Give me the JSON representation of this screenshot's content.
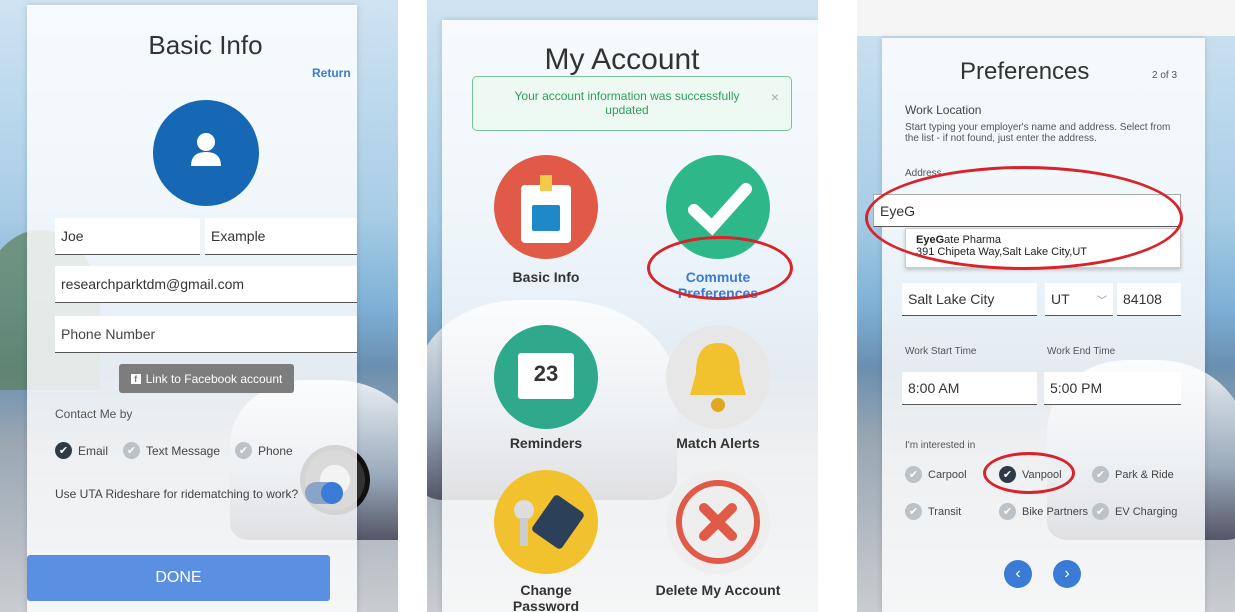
{
  "basic_info": {
    "title": "Basic Info",
    "return_label": "Return",
    "first_name": "Joe",
    "last_name": "Example",
    "email": "researchparktdm@gmail.com",
    "phone_placeholder": "Phone Number",
    "facebook_button": "Link to Facebook account",
    "contact_label": "Contact Me by",
    "contact_options": [
      {
        "label": "Email",
        "checked": true
      },
      {
        "label": "Text Message",
        "checked": false
      },
      {
        "label": "Phone",
        "checked": false
      }
    ],
    "rideshare_label": "Use UTA Rideshare for ridematching to work?",
    "rideshare_toggle": true,
    "done_button": "DONE"
  },
  "my_account": {
    "title": "My Account",
    "alert_message": "Your account information was successfully updated",
    "alert_close": "×",
    "tiles": [
      {
        "label": "Basic Info",
        "icon": "badge-icon"
      },
      {
        "label": "Commute Preferences",
        "icon": "checkmark-icon"
      },
      {
        "label": "Reminders",
        "icon": "calendar-icon"
      },
      {
        "label": "Match Alerts",
        "icon": "bell-icon"
      },
      {
        "label": "Change Password",
        "icon": "key-tag-icon"
      },
      {
        "label": "Delete My Account",
        "icon": "x-icon"
      }
    ],
    "calendar_day": "23"
  },
  "preferences": {
    "title": "Preferences",
    "step": "2 of 3",
    "work_location_label": "Work Location",
    "instructions": "Start typing your employer's name and address. Select from the list - if not found, just enter the address.",
    "address_label": "Address",
    "address_value": "EyeG",
    "suggestion_name_bold": "EyeG",
    "suggestion_name_rest": "ate Pharma",
    "suggestion_address": "391 Chipeta Way,Salt Lake City,UT",
    "city": "Salt Lake City",
    "state": "UT",
    "zip": "84108",
    "start_time_label": "Work Start Time",
    "start_time": "8:00 AM",
    "end_time_label": "Work End Time",
    "end_time": "5:00 PM",
    "interested_label": "I'm interested in",
    "options": [
      {
        "label": "Carpool",
        "checked": false
      },
      {
        "label": "Vanpool",
        "checked": true
      },
      {
        "label": "Park & Ride",
        "checked": false
      },
      {
        "label": "Transit",
        "checked": false
      },
      {
        "label": "Bike Partners",
        "checked": false
      },
      {
        "label": "EV Charging",
        "checked": false
      }
    ]
  },
  "colors": {
    "accent": "#5b8fe2",
    "link": "#3a7bd5",
    "highlight": "#d8232a",
    "success": "#2e9e5b"
  }
}
